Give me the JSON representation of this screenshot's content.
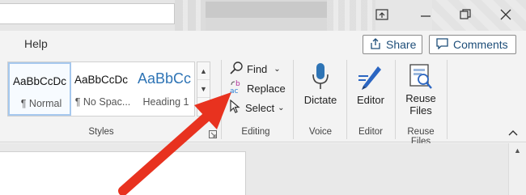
{
  "menu": {
    "help_label": "Help"
  },
  "header": {
    "share_label": "Share",
    "comments_label": "Comments"
  },
  "styles": {
    "items": [
      {
        "preview": "AaBbCcDc",
        "name": "¶ Normal"
      },
      {
        "preview": "AaBbCcDc",
        "name": "¶ No Spac..."
      },
      {
        "preview": "AaBbCc",
        "name": "Heading 1"
      }
    ],
    "group_label": "Styles"
  },
  "editing": {
    "find_label": "Find",
    "replace_label": "Replace",
    "select_label": "Select",
    "group_label": "Editing"
  },
  "voice": {
    "dictate_label": "Dictate",
    "group_label": "Voice"
  },
  "editor": {
    "editor_label": "Editor",
    "group_label": "Editor"
  },
  "reuse": {
    "reuse_label_line1": "Reuse",
    "reuse_label_line2": "Files",
    "group_label": "Reuse Files"
  },
  "colors": {
    "accent": "#2b579a",
    "arrow": "#e8321f",
    "heading": "#2e74b5"
  }
}
